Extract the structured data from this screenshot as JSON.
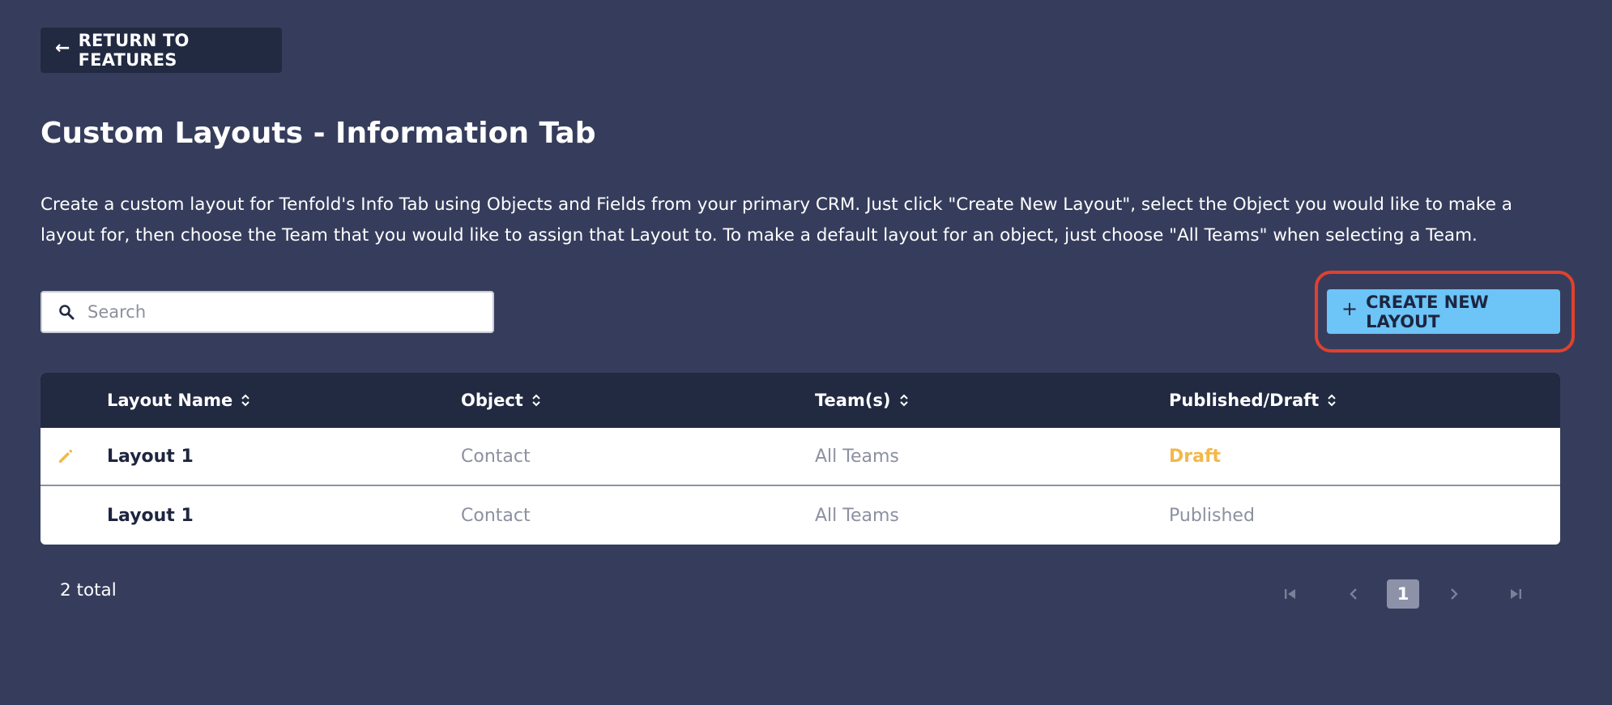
{
  "header": {
    "back_label": "RETURN TO FEATURES",
    "title": "Custom Layouts - Information Tab",
    "description": "Create a custom layout for Tenfold's Info Tab using Objects and Fields from your primary CRM. Just click \"Create New Layout\", select the Object you would like to make a layout for, then choose the Team that you would like to assign that Layout to. To make a default layout for an object, just choose \"All Teams\" when selecting a Team."
  },
  "toolbar": {
    "search_placeholder": "Search",
    "search_value": "",
    "create_label": "CREATE NEW LAYOUT"
  },
  "table": {
    "columns": [
      "Layout Name",
      "Object",
      "Team(s)",
      "Published/Draft"
    ],
    "rows": [
      {
        "name": "Layout 1",
        "object": "Contact",
        "teams": "All Teams",
        "status": "Draft"
      },
      {
        "name": "Layout 1",
        "object": "Contact",
        "teams": "All Teams",
        "status": "Published"
      }
    ]
  },
  "footer": {
    "total": "2 total",
    "current_page": "1"
  },
  "icons": {
    "back": "arrow-left-icon",
    "search": "magnifier-icon",
    "create": "plus-icon",
    "sort": "sort-chevrons-icon",
    "edit": "pencil-icon",
    "first": "first-page-icon",
    "prev": "chevron-left-icon",
    "next": "chevron-right-icon",
    "last": "last-page-icon"
  },
  "colors": {
    "background": "#363d5c",
    "panel_dark": "#222a42",
    "accent": "#6cc4f7",
    "highlight": "#e0412f",
    "draft": "#f2b84b",
    "muted": "#8c90a0"
  }
}
